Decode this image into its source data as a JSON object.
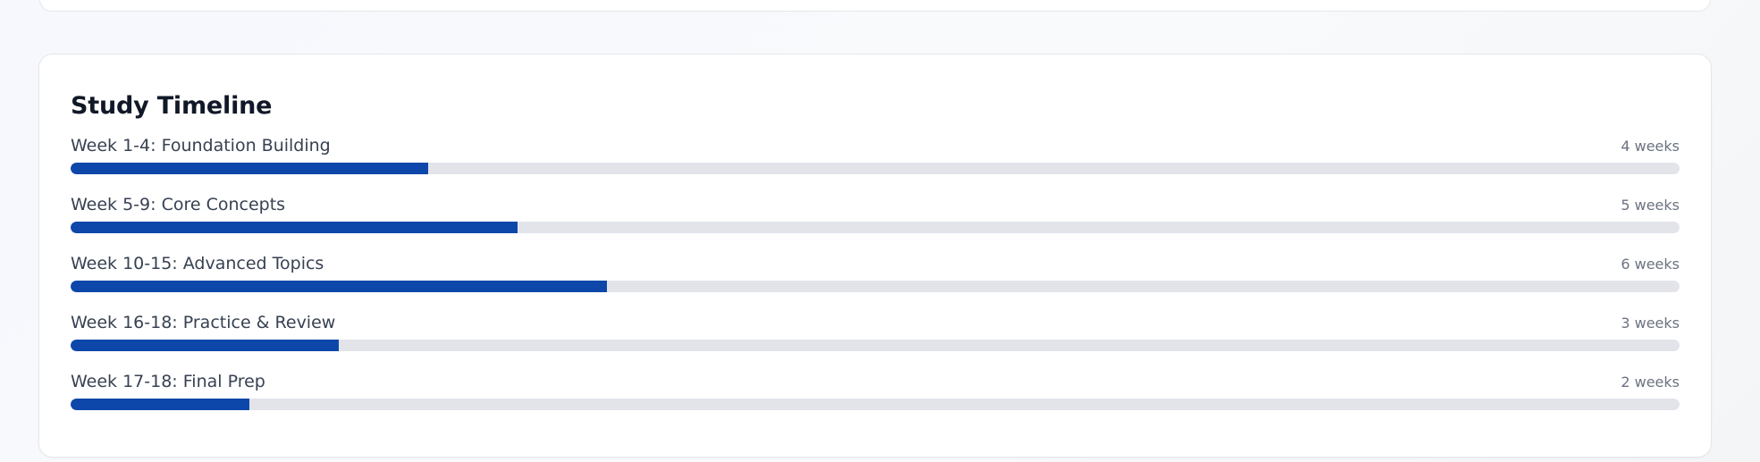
{
  "timeline": {
    "title": "Study Timeline",
    "accent_color": "#0d47a9",
    "track_color": "#e2e4ea",
    "total_weeks": 18,
    "items": [
      {
        "label": "Week 1-4: Foundation Building",
        "duration": "4 weeks",
        "weeks": 4
      },
      {
        "label": "Week 5-9: Core Concepts",
        "duration": "5 weeks",
        "weeks": 5
      },
      {
        "label": "Week 10-15: Advanced Topics",
        "duration": "6 weeks",
        "weeks": 6
      },
      {
        "label": "Week 16-18: Practice & Review",
        "duration": "3 weeks",
        "weeks": 3
      },
      {
        "label": "Week 17-18: Final Prep",
        "duration": "2 weeks",
        "weeks": 2
      }
    ]
  }
}
